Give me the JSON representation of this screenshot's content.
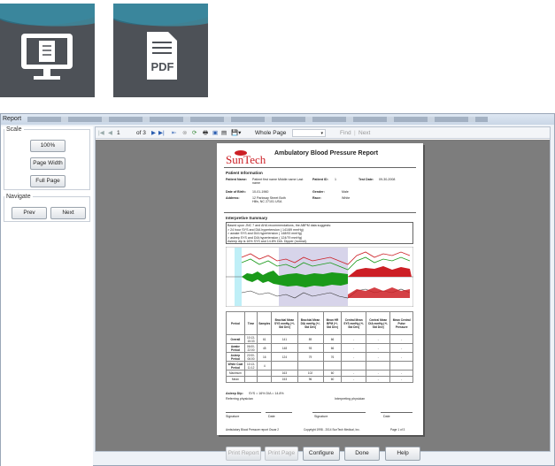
{
  "icons": {
    "tile1": "monitor-document-icon",
    "tile2": "pdf-file-icon",
    "tile2_text": "PDF"
  },
  "window": {
    "title": "Report"
  },
  "scale": {
    "legend": "Scale",
    "btn_100": "100%",
    "btn_page_width": "Page Width",
    "btn_full_page": "Full Page"
  },
  "navigate": {
    "legend": "Navigate",
    "prev": "Prev",
    "next": "Next"
  },
  "toolbar": {
    "page_current": "1",
    "page_of": "of 3",
    "zoom": "Whole Page",
    "find": "Find",
    "next": "Next"
  },
  "report": {
    "logo": "SunTech",
    "title": "Ambulatory Blood Pressure Report",
    "patient_info_heading": "Patient Information",
    "patient_name_label": "Patient Name:",
    "patient_name_value": "Patient first name Middle name Last name",
    "patient_id_label": "Patient ID:",
    "patient_id_value": "1",
    "test_date_label": "Test Date:",
    "test_date_value": "09-30-2008",
    "dob_label": "Date of Birth:",
    "dob_value": "10-01-1960",
    "gender_label": "Gender:",
    "gender_value": "Male",
    "address_label": "Address:",
    "address_value": "12 Parkway Street Both Hills, NC 27101 USA",
    "race_label": "Race:",
    "race_value": "White",
    "interp_heading": "Interpretive Summary",
    "interp_lines": [
      "Based upon JNC 7 and AHA recommendations, the ABPM data suggests:",
      "> 24 hour SYS and DIA hypertension ( 141/89 mmHg)",
      "> awake SYS and DIA hypertension ( 148/93 mmHg)",
      "> asleep SYS and DIA hypertension ( 124/79 mmHg)",
      "Asleep dip is 16% SYS and 14.8% DIA. Dipper (normal)."
    ],
    "table_headers": [
      "Period",
      "Time",
      "Samples",
      "Brachial Mean SYS mmHg (+/- Std Dev)",
      "Brachial Mean DIA mmHg (+/- Std Dev)",
      "Mean HR BPM (+/- Std Dev)",
      "Central Mean SYS mmHg (+/- Std Dev)",
      "Central Mean DIA mmHg (+/- Std Dev)",
      "Mean Central Pulse Pressure"
    ],
    "table_rows": [
      [
        "Overall",
        "10:13-15:33",
        "61",
        "141",
        "89",
        "66",
        "-",
        "-",
        "-"
      ],
      [
        "Awake Period",
        "06:00-22:00",
        "45",
        "148",
        "93",
        "66",
        "-",
        "-",
        "-"
      ],
      [
        "Asleep Period",
        "22:00-06:00",
        "16",
        "124",
        "79",
        "76",
        "-",
        "-",
        "-"
      ],
      [
        "White Coat Period",
        "10:13-11:12",
        "4",
        "",
        "",
        "",
        "",
        "",
        ""
      ],
      [
        "Maximum",
        "",
        "",
        "163",
        "102",
        "60",
        "-",
        "-",
        "-"
      ],
      [
        "Mean",
        "",
        "",
        "153",
        "96",
        "60",
        "-",
        "-",
        "-"
      ]
    ],
    "asleep_dip_label": "Asleep Dip:",
    "asleep_dip_value": "SYS = 16%  DIA = 14.8%",
    "referring_label": "Referring physician",
    "interpreting_label": "Interpreting physician",
    "signature": "Signature",
    "date": "Date",
    "footer_left": "Ambulatory Blood Pressure report   Oscar 2",
    "footer_mid": "Copyright 1998 - 2014 SunTech Medical, Inc.",
    "footer_right": "Page 1 of 3"
  },
  "bottom": {
    "print_report": "Print Report",
    "print_page": "Print Page",
    "configure": "Configure",
    "done": "Done",
    "help": "Help"
  }
}
